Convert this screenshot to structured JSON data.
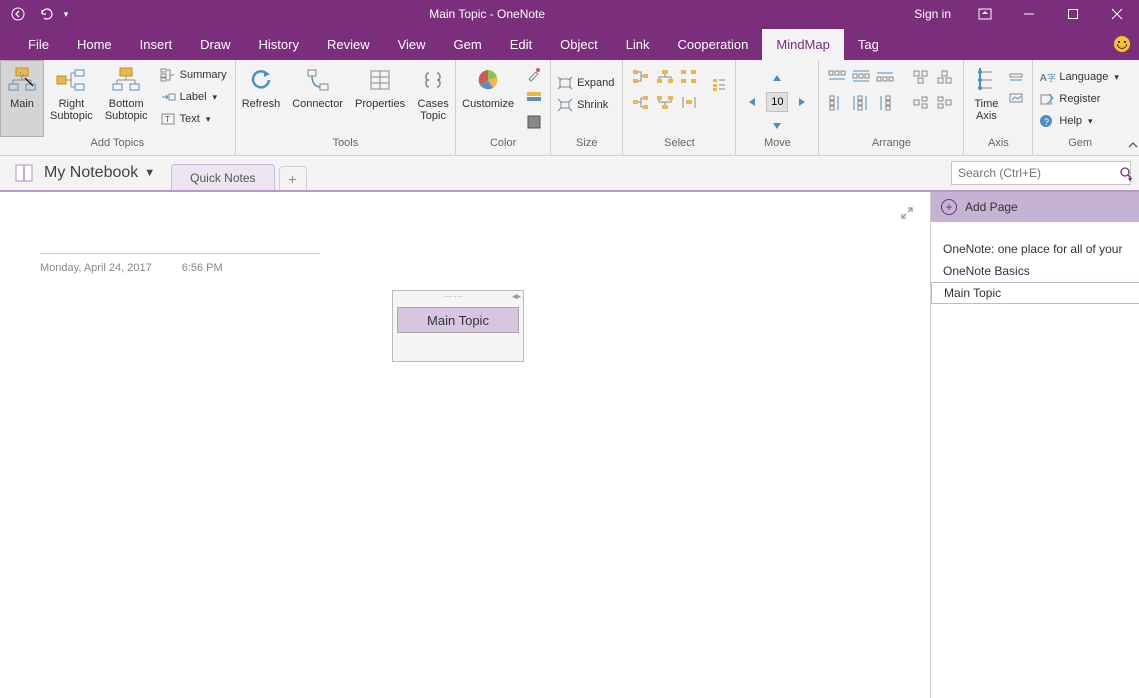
{
  "titlebar": {
    "title": "Main Topic  -  OneNote",
    "signin": "Sign in"
  },
  "tabs": {
    "file": "File",
    "items": [
      "Home",
      "Insert",
      "Draw",
      "History",
      "Review",
      "View",
      "Gem",
      "Edit",
      "Object",
      "Link",
      "Cooperation",
      "MindMap",
      "Tag"
    ],
    "active": "MindMap"
  },
  "ribbon": {
    "addTopics": {
      "label": "Add Topics",
      "main": "Main",
      "right": "Right\nSubtopic",
      "bottom": "Bottom\nSubtopic",
      "summary": "Summary",
      "labelbtn": "Label",
      "text": "Text"
    },
    "tools": {
      "label": "Tools",
      "refresh": "Refresh",
      "connector": "Connector",
      "properties": "Properties",
      "cases": "Cases\nTopic"
    },
    "color": {
      "label": "Color",
      "customize": "Customize"
    },
    "size": {
      "label": "Size",
      "expand": "Expand",
      "shrink": "Shrink"
    },
    "select": {
      "label": "Select"
    },
    "move": {
      "label": "Move",
      "value": "10"
    },
    "arrange": {
      "label": "Arrange"
    },
    "axis": {
      "label": "Axis",
      "time": "Time\nAxis"
    },
    "gem": {
      "label": "Gem",
      "language": "Language",
      "register": "Register",
      "help": "Help"
    }
  },
  "notebook": {
    "name": "My Notebook",
    "section": "Quick Notes",
    "searchPlaceholder": "Search (Ctrl+E)"
  },
  "canvas": {
    "date": "Monday, April 24, 2017",
    "time": "6:56 PM",
    "mainTopic": "Main Topic"
  },
  "sidepanel": {
    "addPage": "Add Page",
    "pages": [
      "OneNote: one place for all of your",
      "OneNote Basics",
      "Main Topic"
    ],
    "selected": "Main Topic"
  }
}
